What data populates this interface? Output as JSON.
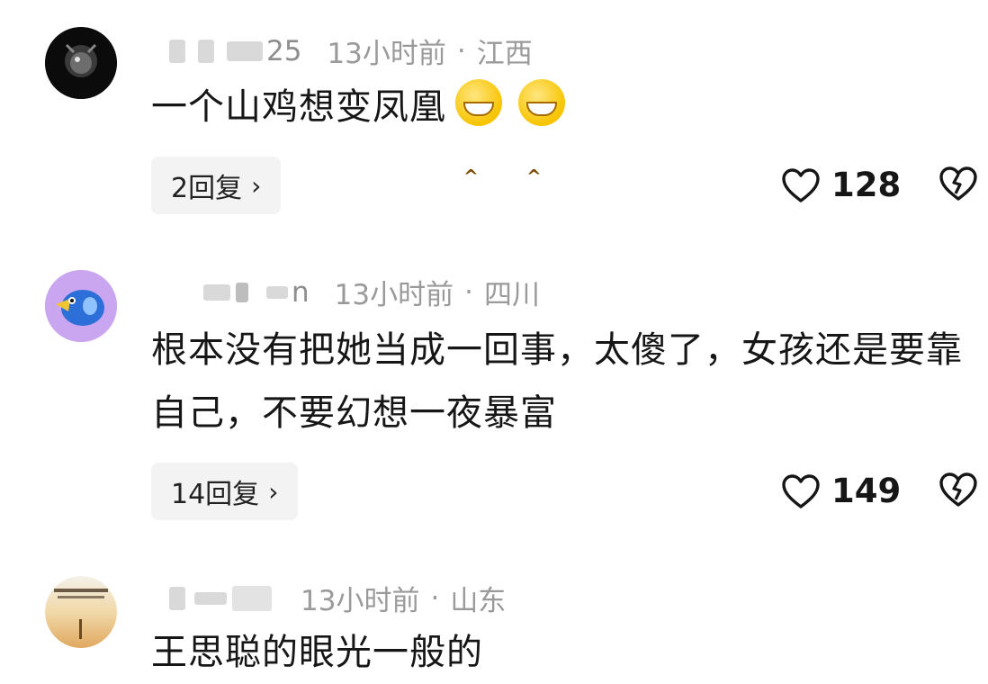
{
  "comments": [
    {
      "username_suffix": "25",
      "time": "13小时前",
      "dot": "·",
      "location": "江西",
      "text": "一个山鸡想变凤凰",
      "emoji": [
        "grinning-emoji",
        "grinning-emoji"
      ],
      "replies": "2回复",
      "likes": "128"
    },
    {
      "username_suffix": "n",
      "time": "13小时前",
      "dot": "·",
      "location": "四川",
      "text": "根本没有把她当成一回事，太傻了，女孩还是要靠自己，不要幻想一夜暴富",
      "replies": "14回复",
      "likes": "149"
    },
    {
      "username_suffix": "",
      "time": "13小时前",
      "dot": "·",
      "location": "山东",
      "text": "王思聪的眼光一般的"
    }
  ],
  "icons": {
    "chevron": "›",
    "like": "heart-outline-icon",
    "dislike": "broken-heart-icon"
  },
  "colors": {
    "text": "#161616",
    "meta": "#9a9a9a",
    "reply_bg": "#f3f3f3"
  }
}
